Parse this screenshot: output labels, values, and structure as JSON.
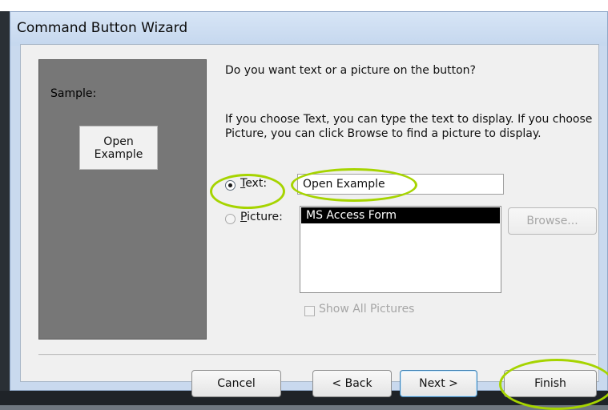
{
  "window": {
    "title": "Command Button Wizard"
  },
  "sample": {
    "label": "Sample:",
    "button_text": "Open\nExample"
  },
  "prompt": {
    "question": "Do you want text or a picture on the button?",
    "explanation": "If you choose Text, you can type the text to display.  If you choose Picture, you can click Browse to find a picture to display."
  },
  "options": {
    "text_option": {
      "label": "Text:",
      "underline": "T",
      "selected": true
    },
    "text_value": "Open Example",
    "picture_option": {
      "label": "Picture:",
      "underline": "P",
      "selected": false
    },
    "picture_list": {
      "items": [
        "MS Access Form"
      ],
      "selected_index": 0
    },
    "browse_label": "Browse...",
    "show_all_pictures_label": "Show All Pictures"
  },
  "footer": {
    "cancel_label": "Cancel",
    "back_label": "< Back",
    "next_label": "Next >",
    "finish_label": "Finish"
  },
  "colors": {
    "highlight_ring": "#a6d400"
  }
}
